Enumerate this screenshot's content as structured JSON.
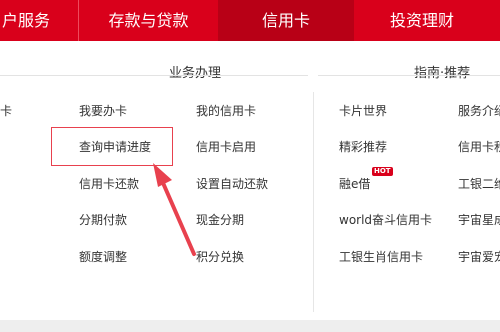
{
  "nav": {
    "items": [
      {
        "label": "户服务"
      },
      {
        "label": "存款与贷款"
      },
      {
        "label": "信用卡"
      },
      {
        "label": "投资理财"
      }
    ]
  },
  "sections": {
    "business_title": "业务办理",
    "guide_title": "指南·推荐"
  },
  "business_links": {
    "col0": [
      "卡"
    ],
    "col1": [
      "我要办卡",
      "查询申请进度",
      "信用卡还款",
      "分期付款",
      "额度调整"
    ],
    "col2": [
      "我的信用卡",
      "信用卡启用",
      "设置自动还款",
      "现金分期",
      "积分兑换"
    ]
  },
  "guide_links": {
    "col1": [
      "卡片世界",
      "精彩推荐",
      "融e借",
      "world奋斗信用卡",
      "工银生肖信用卡"
    ],
    "col2": [
      "服务介绍",
      "信用卡积",
      "工银二维",
      "宇宙星成",
      "宇宙爱宠"
    ]
  },
  "badge": {
    "hot": "HOT"
  },
  "colors": {
    "brand": "#d9001b",
    "active_nav": "#b80016",
    "highlight": "#e8414e"
  }
}
